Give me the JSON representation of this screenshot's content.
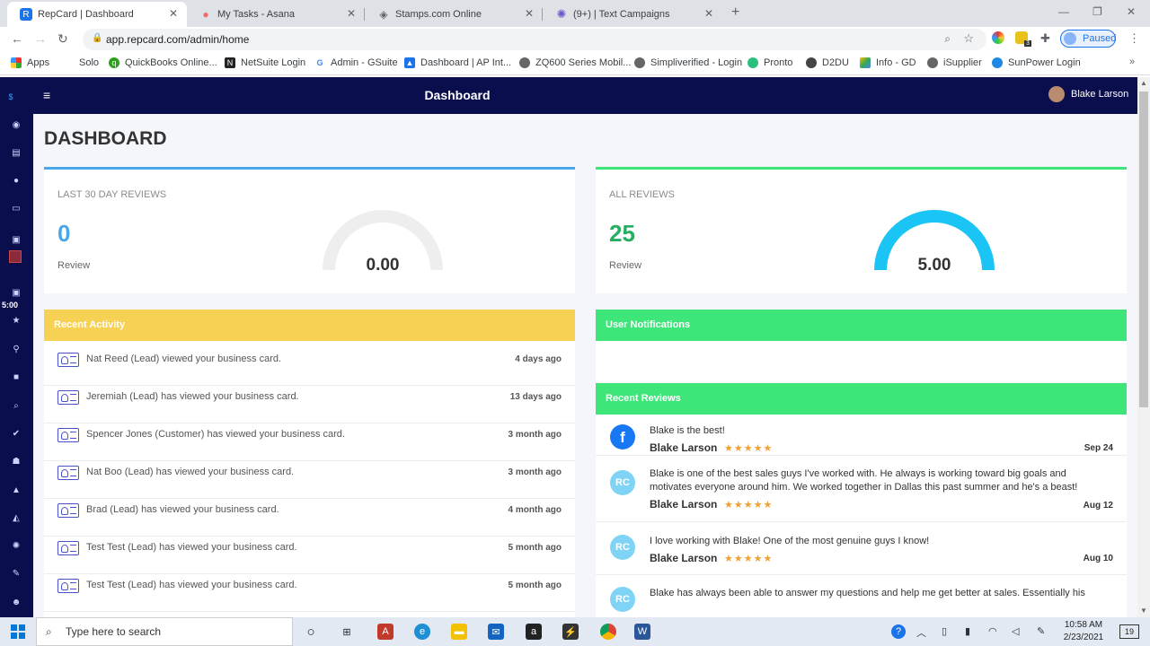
{
  "browser": {
    "tabs": [
      {
        "title": "RepCard | Dashboard",
        "active": true
      },
      {
        "title": "My Tasks - Asana",
        "active": false
      },
      {
        "title": "Stamps.com Online",
        "active": false
      },
      {
        "title": "(9+) | Text Campaigns",
        "active": false
      }
    ],
    "url": "app.repcard.com/admin/home",
    "paused_label": "Paused",
    "bookmarks": [
      "Apps",
      "Solo",
      "QuickBooks Online...",
      "NetSuite Login",
      "Admin - GSuite",
      "Dashboard | AP Int...",
      "ZQ600 Series Mobil...",
      "Simpliverified - Login",
      "Pronto",
      "D2DU",
      "Info - GD",
      "iSupplier",
      "SunPower Login"
    ],
    "ext_badge": "3"
  },
  "app": {
    "nav_title": "Dashboard",
    "user_name": "Blake Larson",
    "timer": "5:00",
    "page_title": "DASHBOARD",
    "stats": [
      {
        "label": "LAST 30 DAY REVIEWS",
        "count": "0",
        "sub": "Review",
        "gauge": "0.00",
        "gauge_fraction": 0,
        "color": "#4aa8e8"
      },
      {
        "label": "ALL REVIEWS",
        "count": "25",
        "sub": "Review",
        "gauge": "5.00",
        "gauge_fraction": 1,
        "color": "#27ae60"
      }
    ],
    "recent_activity_header": "Recent Activity",
    "user_notifications_header": "User Notifications",
    "recent_reviews_header": "Recent Reviews",
    "activity": [
      {
        "text": "Nat Reed (Lead) viewed your business card.",
        "time": "4 days ago"
      },
      {
        "text": "Jeremiah (Lead) has viewed your business card.",
        "time": "13 days ago"
      },
      {
        "text": "Spencer Jones (Customer) has viewed your business card.",
        "time": "3 month ago"
      },
      {
        "text": "Nat Boo (Lead) has viewed your business card.",
        "time": "3 month ago"
      },
      {
        "text": "Brad (Lead) has viewed your business card.",
        "time": "4 month ago"
      },
      {
        "text": "Test Test (Lead) has viewed your business card.",
        "time": "5 month ago"
      },
      {
        "text": "Test Test (Lead) has viewed your business card.",
        "time": "5 month ago"
      }
    ],
    "reviews": [
      {
        "source": "facebook",
        "text": "Blake is the best!",
        "name": "Blake Larson",
        "stars": "★★★★★",
        "date": "Sep 24"
      },
      {
        "source": "repcard",
        "text": "Blake is one of the best sales guys I've worked with. He always is working toward big goals and motivates everyone around him. We worked together in Dallas this past summer and he's a beast!",
        "name": "Blake Larson",
        "stars": "★★★★★",
        "date": "Aug 12"
      },
      {
        "source": "repcard",
        "text": "I love working with Blake! One of the most genuine guys I know!",
        "name": "Blake Larson",
        "stars": "★★★★★",
        "date": "Aug 10"
      },
      {
        "source": "repcard",
        "text": "Blake has always been able to answer my questions and help me get better at sales. Essentially his",
        "name": "",
        "stars": "",
        "date": ""
      }
    ]
  },
  "taskbar": {
    "search_placeholder": "Type here to search",
    "time": "10:58 AM",
    "date": "2/23/2021",
    "notif_count": "19"
  },
  "colors": {
    "nav": "#0b0e4d",
    "activity_header": "#f7d154",
    "green_header": "#3ee67a",
    "gauge": "#1ac4f5"
  }
}
